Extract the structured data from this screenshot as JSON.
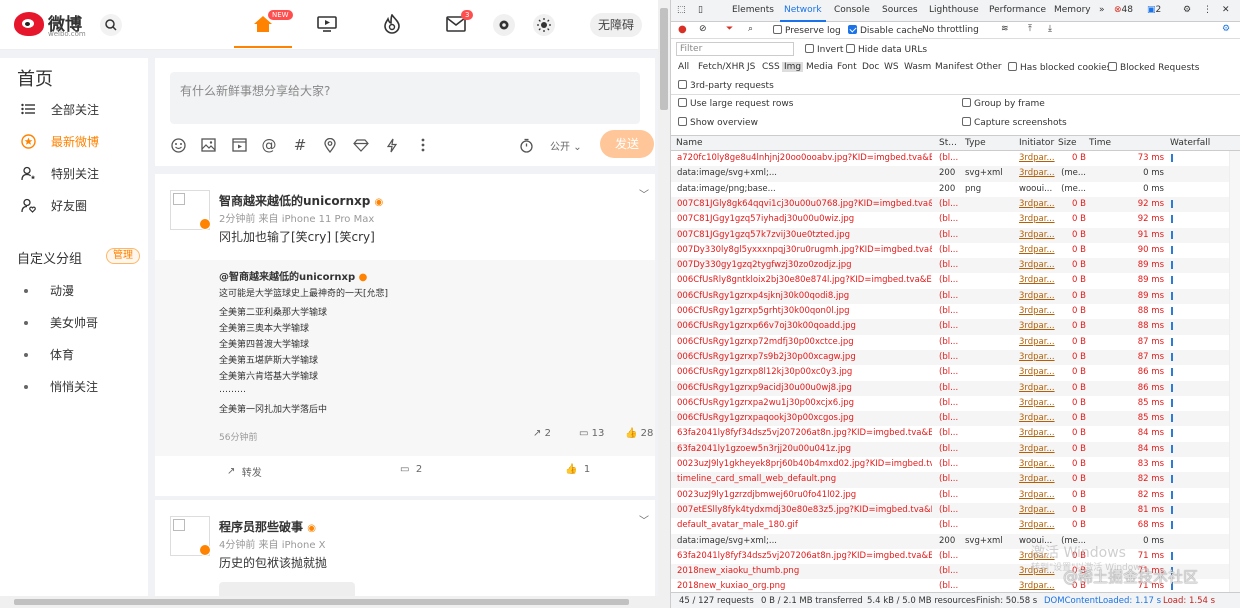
{
  "weibo": {
    "logo_text": "微博",
    "logo_sub": "weibo.com",
    "nav_badge_new": "NEW",
    "nav_badge_mail": "3",
    "accessibility": "无障碍",
    "side": {
      "title": "首页",
      "items": [
        {
          "label": "全部关注"
        },
        {
          "label": "最新微博"
        },
        {
          "label": "特别关注"
        },
        {
          "label": "好友圈"
        }
      ],
      "group_title": "自定义分组",
      "manage": "管理",
      "groups": [
        {
          "label": "动漫"
        },
        {
          "label": "美女帅哥"
        },
        {
          "label": "体育"
        },
        {
          "label": "悄悄关注"
        }
      ]
    },
    "compose": {
      "placeholder": "有什么新鲜事想分享给大家?",
      "visibility": "公开",
      "send": "发送"
    },
    "post1": {
      "name": "智商越来越低的unicornxp",
      "meta": "2分钟前  来自 iPhone 11 Pro Max",
      "text": "冈扎加也输了[笑cry] [笑cry]",
      "repost": {
        "name": "@智商越来越低的unicornxp",
        "lines": [
          "这可能是大学篮球史上最神奇的一天[允悲]",
          "全美第二亚利桑那大学输球",
          "全美第三奥本大学输球",
          "全美第四普渡大学输球",
          "全美第五堪萨斯大学输球",
          "全美第六肯塔基大学输球",
          "………",
          "全美第一冈扎加大学落后中"
        ],
        "time": "56分钟前",
        "reposts": "2",
        "comments": "13",
        "likes": "28"
      },
      "actions": {
        "repost": "转发",
        "comments": "2",
        "likes": "1"
      }
    },
    "post2": {
      "name": "程序员那些破事",
      "meta": "4分钟前  来自 iPhone X",
      "text": "历史的包袱该抛就抛"
    }
  },
  "devtools": {
    "tabs": [
      "Elements",
      "Network",
      "Console",
      "Sources",
      "Lighthouse",
      "Performance",
      "Memory"
    ],
    "errors": "48",
    "warnings": "2",
    "toolbar": {
      "preserve_log": "Preserve log",
      "disable_cache": "Disable cache",
      "throttling": "No throttling"
    },
    "filter_placeholder": "Filter",
    "invert": "Invert",
    "hide_data_urls": "Hide data URLs",
    "types": [
      "All",
      "Fetch/XHR",
      "JS",
      "CSS",
      "Img",
      "Media",
      "Font",
      "Doc",
      "WS",
      "Wasm",
      "Manifest",
      "Other"
    ],
    "has_blocked": "Has blocked cookies",
    "blocked_requests": "Blocked Requests",
    "third_party": "3rd-party requests",
    "large_rows": "Use large request rows",
    "group_frame": "Group by frame",
    "overview": "Show overview",
    "screenshots": "Capture screenshots",
    "columns": [
      "Name",
      "St...",
      "Type",
      "Initiator",
      "Size",
      "Time",
      "Waterfall"
    ],
    "requests": [
      {
        "name": "a720fc10ly8ge8u4lnhjnj20oo0ooabv.jpg?KID=imgbed.tva&Ex...",
        "status": "(bl...",
        "type": "",
        "init": "3rdpar...",
        "size": "0 B",
        "time": "73 ms",
        "red": true
      },
      {
        "name": "data:image/svg+xml;...",
        "status": "200",
        "type": "svg+xml",
        "init": "3rdpar...",
        "size": "(me...",
        "time": "0 ms",
        "red": false
      },
      {
        "name": "data:image/png;base...",
        "status": "200",
        "type": "png",
        "init": "wooui...",
        "size": "(me...",
        "time": "0 ms",
        "red": false
      },
      {
        "name": "007C81JGly8gk64qqvi1cj30u00u0768.jpg?KID=imgbed.tva&E...",
        "status": "(bl...",
        "type": "",
        "init": "3rdpar...",
        "size": "0 B",
        "time": "92 ms",
        "red": true
      },
      {
        "name": "007C81JGgy1gzq57iyhadj30u00u0wiz.jpg",
        "status": "(bl...",
        "type": "",
        "init": "3rdpar...",
        "size": "0 B",
        "time": "92 ms",
        "red": true
      },
      {
        "name": "007C81JGgy1gzq57k7zvij30ue0tzted.jpg",
        "status": "(bl...",
        "type": "",
        "init": "3rdpar...",
        "size": "0 B",
        "time": "91 ms",
        "red": true
      },
      {
        "name": "007Dy330ly8gl5yxxxnpqj30ru0rugmh.jpg?KID=imgbed.tva&E...",
        "status": "(bl...",
        "type": "",
        "init": "3rdpar...",
        "size": "0 B",
        "time": "90 ms",
        "red": true
      },
      {
        "name": "007Dy330gy1gzq2tygfwzj30zo0zodjz.jpg",
        "status": "(bl...",
        "type": "",
        "init": "3rdpar...",
        "size": "0 B",
        "time": "89 ms",
        "red": true
      },
      {
        "name": "006CfUsRly8gntkloix2bj30e80e874l.jpg?KID=imgbed.tva&E...",
        "status": "(bl...",
        "type": "",
        "init": "3rdpar...",
        "size": "0 B",
        "time": "89 ms",
        "red": true
      },
      {
        "name": "006CfUsRgy1gzrxp4sjknj30k00qodi8.jpg",
        "status": "(bl...",
        "type": "",
        "init": "3rdpar...",
        "size": "0 B",
        "time": "89 ms",
        "red": true
      },
      {
        "name": "006CfUsRgy1gzrxp5grhtj30k00qon0l.jpg",
        "status": "(bl...",
        "type": "",
        "init": "3rdpar...",
        "size": "0 B",
        "time": "88 ms",
        "red": true
      },
      {
        "name": "006CfUsRgy1gzrxp66v7oj30k00qoadd.jpg",
        "status": "(bl...",
        "type": "",
        "init": "3rdpar...",
        "size": "0 B",
        "time": "88 ms",
        "red": true
      },
      {
        "name": "006CfUsRgy1gzrxp72mdfj30p00xctce.jpg",
        "status": "(bl...",
        "type": "",
        "init": "3rdpar...",
        "size": "0 B",
        "time": "87 ms",
        "red": true
      },
      {
        "name": "006CfUsRgy1gzrxp7s9b2j30p00xcagw.jpg",
        "status": "(bl...",
        "type": "",
        "init": "3rdpar...",
        "size": "0 B",
        "time": "87 ms",
        "red": true
      },
      {
        "name": "006CfUsRgy1gzrxp8l12kj30p00xc0y3.jpg",
        "status": "(bl...",
        "type": "",
        "init": "3rdpar...",
        "size": "0 B",
        "time": "86 ms",
        "red": true
      },
      {
        "name": "006CfUsRgy1gzrxp9acidj30u00u0wj8.jpg",
        "status": "(bl...",
        "type": "",
        "init": "3rdpar...",
        "size": "0 B",
        "time": "86 ms",
        "red": true
      },
      {
        "name": "006CfUsRgy1gzrxpa2wu1j30p00xcjx6.jpg",
        "status": "(bl...",
        "type": "",
        "init": "3rdpar...",
        "size": "0 B",
        "time": "85 ms",
        "red": true
      },
      {
        "name": "006CfUsRgy1gzrxpaqookj30p00xcgos.jpg",
        "status": "(bl...",
        "type": "",
        "init": "3rdpar...",
        "size": "0 B",
        "time": "85 ms",
        "red": true
      },
      {
        "name": "63fa2041ly8fyf34dsz5vj207206at8n.jpg?KID=imgbed.tva&Exp...",
        "status": "(bl...",
        "type": "",
        "init": "3rdpar...",
        "size": "0 B",
        "time": "84 ms",
        "red": true
      },
      {
        "name": "63fa2041ly1gzoew5n3rjj20u00u041z.jpg",
        "status": "(bl...",
        "type": "",
        "init": "3rdpar...",
        "size": "0 B",
        "time": "84 ms",
        "red": true
      },
      {
        "name": "0023uzJ9ly1gkheyek8prj60b40b4mxd02.jpg?KID=imgbed.tva&...",
        "status": "(bl...",
        "type": "",
        "init": "3rdpar...",
        "size": "0 B",
        "time": "83 ms",
        "red": true
      },
      {
        "name": "timeline_card_small_web_default.png",
        "status": "(bl...",
        "type": "",
        "init": "3rdpar...",
        "size": "0 B",
        "time": "82 ms",
        "red": true
      },
      {
        "name": "0023uzJ9ly1gzrzdjbmwej60ru0fo41l02.jpg",
        "status": "(bl...",
        "type": "",
        "init": "3rdpar...",
        "size": "0 B",
        "time": "82 ms",
        "red": true
      },
      {
        "name": "007etESlly8fyk4tydxmdj30e80e83z5.jpg?KID=imgbed.tva&E...",
        "status": "(bl...",
        "type": "",
        "init": "3rdpar...",
        "size": "0 B",
        "time": "81 ms",
        "red": true
      },
      {
        "name": "default_avatar_male_180.gif",
        "status": "(bl...",
        "type": "",
        "init": "3rdpar...",
        "size": "0 B",
        "time": "68 ms",
        "red": true
      },
      {
        "name": "data:image/svg+xml;...",
        "status": "200",
        "type": "svg+xml",
        "init": "wooui...",
        "size": "(me...",
        "time": "0 ms",
        "red": false
      },
      {
        "name": "63fa2041ly8fyf34dsz5vj207206at8n.jpg?KID=imgbed.tva&Exp...",
        "status": "(bl...",
        "type": "",
        "init": "3rdpar...",
        "size": "0 B",
        "time": "71 ms",
        "red": true
      },
      {
        "name": "2018new_xiaoku_thumb.png",
        "status": "(bl...",
        "type": "",
        "init": "3rdpar...",
        "size": "0 B",
        "time": "71 ms",
        "red": true
      },
      {
        "name": "2018new_kuxiao_org.png",
        "status": "(bl...",
        "type": "",
        "init": "3rdpar...",
        "size": "0 B",
        "time": "71 ms",
        "red": true
      }
    ],
    "status_bar": {
      "requests": "45 / 127 requests",
      "transferred": "0 B / 2.1 MB transferred",
      "resources": "5.4 kB / 5.0 MB resources",
      "finish": "Finish: 50.58 s",
      "dcl": "DOMContentLoaded: 1.17 s",
      "load": "Load: 1.54 s"
    },
    "watermark": "@稀土掘金技术社区",
    "win_wm1": "激活 Windows",
    "win_wm2": "转到\"设置\"以激活 Windows。"
  }
}
